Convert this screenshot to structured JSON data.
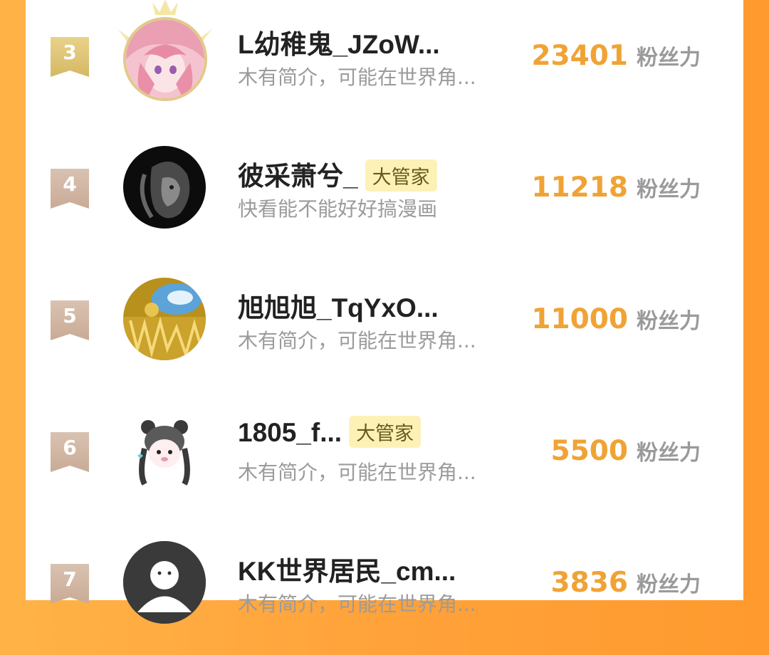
{
  "colors": {
    "accent": "#f0a335",
    "background_orange": "#ffa23a",
    "bio_gray": "#9b9b9b",
    "badge_bg": "#fdf1b8"
  },
  "fans_unit": "粉丝力",
  "rows": [
    {
      "rank": "3",
      "name": "L幼稚鬼_JZoW...",
      "badge": "",
      "bio": "木有简介，可能在世界角...",
      "fans": "23401",
      "avatar_icon": "anime-girl-avatar"
    },
    {
      "rank": "4",
      "name": "彼采萧兮_",
      "badge": "大管家",
      "bio": "快看能不能好好搞漫画",
      "fans": "11218",
      "avatar_icon": "lion-avatar"
    },
    {
      "rank": "5",
      "name": "旭旭旭_TqYxO...",
      "badge": "",
      "bio": "木有简介，可能在世界角...",
      "fans": "11000",
      "avatar_icon": "golden-scene-avatar"
    },
    {
      "rank": "6",
      "name": "1805_f...",
      "badge": "大管家",
      "bio": "木有简介，可能在世界角...",
      "fans": "5500",
      "avatar_icon": "bear-girl-avatar"
    },
    {
      "rank": "7",
      "name": "KK世界居民_cm...",
      "badge": "",
      "bio": "木有简介，可能在世界角...",
      "fans": "3836",
      "avatar_icon": "default-user-avatar"
    }
  ]
}
